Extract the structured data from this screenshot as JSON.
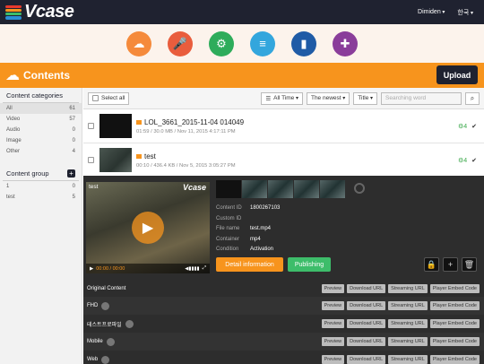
{
  "brand": {
    "name": "Vcase",
    "colors": [
      "#e8392d",
      "#f7941d",
      "#3dbd6a",
      "#2a8fd6"
    ]
  },
  "header": {
    "user_menu": "Dimiden",
    "lang_menu": "한국"
  },
  "categories_bar": [
    {
      "icon": "cloud-upload-icon",
      "color": "#f58a3b"
    },
    {
      "icon": "microphone-icon",
      "color": "#e95d3d"
    },
    {
      "icon": "settings-gear-icon",
      "color": "#2eac5b"
    },
    {
      "icon": "database-icon",
      "color": "#33a6dd"
    },
    {
      "icon": "bar-chart-icon",
      "color": "#1f5ba6"
    },
    {
      "icon": "puzzle-icon",
      "color": "#8a3d9a"
    }
  ],
  "section": {
    "title": "Contents",
    "upload_label": "Upload"
  },
  "sidebar": {
    "categories_title": "Content categories",
    "categories": [
      {
        "label": "All",
        "count": "61"
      },
      {
        "label": "Video",
        "count": "57"
      },
      {
        "label": "Audio",
        "count": "0"
      },
      {
        "label": "Image",
        "count": "0"
      },
      {
        "label": "Other",
        "count": "4"
      }
    ],
    "groups_title": "Content group",
    "groups": [
      {
        "label": "1",
        "count": "0"
      },
      {
        "label": "test",
        "count": "5"
      }
    ]
  },
  "toolbar": {
    "select_all": "Select all",
    "time_filter": "All Time",
    "sort": "The newest",
    "field": "Title",
    "search_placeholder": "Searching word"
  },
  "contents": [
    {
      "title": "LOL_3661_2015-11-04 014049",
      "meta": "01:59  /  30.0 MB  /  Nov 11, 2015 4:17:11 PM",
      "badge": "4"
    },
    {
      "title": "test",
      "meta": "00:10  /  436.4 KB  /  Nov 5, 2015 3:05:27 PM",
      "badge": "4"
    }
  ],
  "detail": {
    "player_title": "test",
    "player_brand": "Vcase",
    "time": "00:00 / 00:00",
    "info": [
      {
        "k": "Content ID",
        "v": "1800267103"
      },
      {
        "k": "Custom ID",
        "v": ""
      },
      {
        "k": "File name",
        "v": "test.mp4"
      },
      {
        "k": "Container",
        "v": "mp4"
      },
      {
        "k": "Condition",
        "v": "Activation"
      }
    ],
    "detail_btn": "Detail information",
    "publish_btn": "Publishing"
  },
  "profiles": [
    {
      "name": "Original Content"
    },
    {
      "name": "FHD"
    },
    {
      "name": "테스트프로파일"
    },
    {
      "name": "Mobile"
    },
    {
      "name": "Web"
    }
  ],
  "profile_actions": {
    "preview": "Preview",
    "download": "Download URL",
    "streaming": "Streaming URL",
    "embed": "Player Embed Code"
  }
}
